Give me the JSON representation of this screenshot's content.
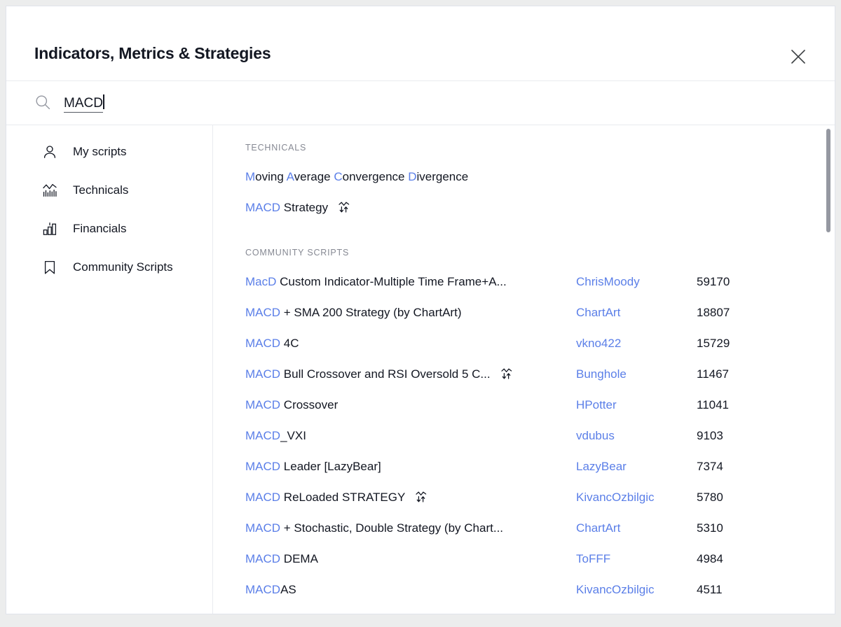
{
  "dialog": {
    "title": "Indicators, Metrics & Strategies",
    "close_label": "×"
  },
  "search": {
    "value": "MACD",
    "placeholder": "Search"
  },
  "sidebar": {
    "items": [
      {
        "label": "My scripts",
        "icon": "person-icon"
      },
      {
        "label": "Technicals",
        "icon": "technicals-chart-icon"
      },
      {
        "label": "Financials",
        "icon": "bar-chart-icon"
      },
      {
        "label": "Community Scripts",
        "icon": "bookmark-icon"
      }
    ]
  },
  "sections": [
    {
      "label": "TECHNICALS",
      "rows": [
        {
          "parts": [
            {
              "t": "M",
              "hl": true
            },
            {
              "t": "oving ",
              "hl": false
            },
            {
              "t": "A",
              "hl": true
            },
            {
              "t": "verage ",
              "hl": false
            },
            {
              "t": "C",
              "hl": true
            },
            {
              "t": "onvergence ",
              "hl": false
            },
            {
              "t": "D",
              "hl": true
            },
            {
              "t": "ivergence",
              "hl": false
            }
          ],
          "strategy": false,
          "author": "",
          "count": ""
        },
        {
          "parts": [
            {
              "t": "MACD",
              "hl": true
            },
            {
              "t": " Strategy",
              "hl": false
            }
          ],
          "strategy": true,
          "author": "",
          "count": ""
        }
      ]
    },
    {
      "label": "COMMUNITY SCRIPTS",
      "rows": [
        {
          "parts": [
            {
              "t": "MacD",
              "hl": true
            },
            {
              "t": " Custom Indicator-Multiple Time Frame+A...",
              "hl": false
            }
          ],
          "strategy": false,
          "author": "ChrisMoody",
          "count": "59170"
        },
        {
          "parts": [
            {
              "t": "MACD",
              "hl": true
            },
            {
              "t": " + SMA 200 Strategy (by ChartArt)",
              "hl": false
            }
          ],
          "strategy": false,
          "author": "ChartArt",
          "count": "18807"
        },
        {
          "parts": [
            {
              "t": "MACD",
              "hl": true
            },
            {
              "t": " 4C",
              "hl": false
            }
          ],
          "strategy": false,
          "author": "vkno422",
          "count": "15729"
        },
        {
          "parts": [
            {
              "t": "MACD",
              "hl": true
            },
            {
              "t": " Bull Crossover and RSI Oversold 5 C...",
              "hl": false
            }
          ],
          "strategy": true,
          "author": "Bunghole",
          "count": "11467"
        },
        {
          "parts": [
            {
              "t": "MACD",
              "hl": true
            },
            {
              "t": " Crossover",
              "hl": false
            }
          ],
          "strategy": false,
          "author": "HPotter",
          "count": "11041"
        },
        {
          "parts": [
            {
              "t": "MACD",
              "hl": true
            },
            {
              "t": "_VXI",
              "hl": false
            }
          ],
          "strategy": false,
          "author": "vdubus",
          "count": "9103"
        },
        {
          "parts": [
            {
              "t": "MACD",
              "hl": true
            },
            {
              "t": " Leader [LazyBear]",
              "hl": false
            }
          ],
          "strategy": false,
          "author": "LazyBear",
          "count": "7374"
        },
        {
          "parts": [
            {
              "t": "MACD",
              "hl": true
            },
            {
              "t": " ReLoaded STRATEGY",
              "hl": false
            }
          ],
          "strategy": true,
          "author": "KivancOzbilgic",
          "count": "5780"
        },
        {
          "parts": [
            {
              "t": "MACD",
              "hl": true
            },
            {
              "t": " + Stochastic, Double Strategy (by Chart...",
              "hl": false
            }
          ],
          "strategy": false,
          "author": "ChartArt",
          "count": "5310"
        },
        {
          "parts": [
            {
              "t": "MACD",
              "hl": true
            },
            {
              "t": " DEMA",
              "hl": false
            }
          ],
          "strategy": false,
          "author": "ToFFF",
          "count": "4984"
        },
        {
          "parts": [
            {
              "t": "MACD",
              "hl": true
            },
            {
              "t": "AS",
              "hl": false
            }
          ],
          "strategy": false,
          "author": "KivancOzbilgic",
          "count": "4511"
        }
      ]
    }
  ],
  "colors": {
    "highlight_blue": "#5b7fe8",
    "text": "#131722",
    "muted": "#868993",
    "border": "#e9ebef",
    "scrollbar": "#9598a1"
  }
}
